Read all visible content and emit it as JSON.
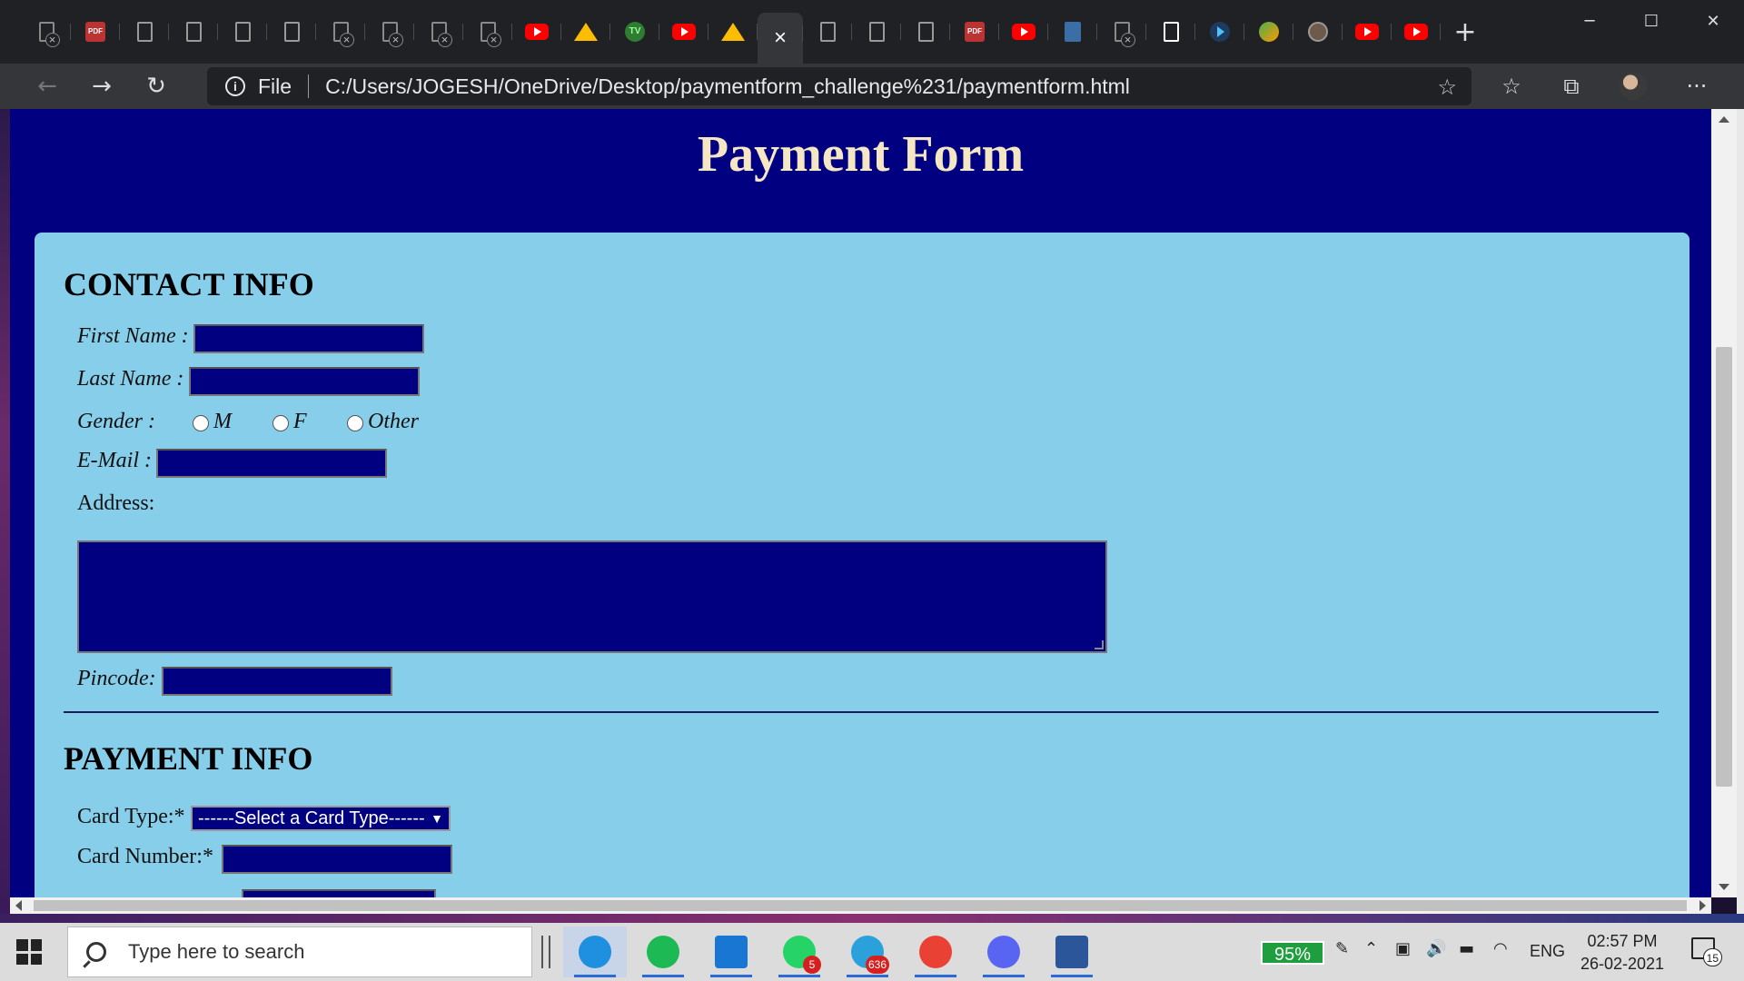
{
  "browser": {
    "tabs": [
      {
        "icon": "blocked-doc-icon"
      },
      {
        "icon": "pdf-icon"
      },
      {
        "icon": "doc-icon"
      },
      {
        "icon": "doc-icon"
      },
      {
        "icon": "doc-icon"
      },
      {
        "icon": "doc-icon"
      },
      {
        "icon": "blocked-doc-icon"
      },
      {
        "icon": "blocked-doc-icon"
      },
      {
        "icon": "blocked-doc-icon"
      },
      {
        "icon": "blocked-doc-icon"
      },
      {
        "icon": "youtube-icon"
      },
      {
        "icon": "google-drive-icon"
      },
      {
        "icon": "tradingview-icon"
      },
      {
        "icon": "youtube-icon"
      },
      {
        "icon": "google-drive-icon"
      },
      {
        "icon": "active-tab",
        "close_glyph": "×"
      },
      {
        "icon": "doc-icon"
      },
      {
        "icon": "doc-icon"
      },
      {
        "icon": "doc-icon"
      },
      {
        "icon": "pdf-icon"
      },
      {
        "icon": "youtube-icon"
      },
      {
        "icon": "book-icon"
      },
      {
        "icon": "blocked-doc-icon"
      },
      {
        "icon": "white-doc-icon"
      },
      {
        "icon": "play-icon"
      },
      {
        "icon": "green-app-icon"
      },
      {
        "icon": "circle-app-icon"
      },
      {
        "icon": "youtube-icon"
      },
      {
        "icon": "youtube-icon"
      }
    ],
    "new_tab_glyph": "+",
    "window_controls": {
      "minimize": "─",
      "maximize": "☐",
      "close": "✕"
    },
    "nav": {
      "back": "←",
      "forward": "→",
      "reload": "↻"
    },
    "address": {
      "scheme_label": "File",
      "url": "C:/Users/JOGESH/OneDrive/Desktop/paymentform_challenge%231/paymentform.html"
    },
    "right_icons": {
      "add_favorite": "☆",
      "favorites": "☆",
      "collections": "⧉",
      "more": "···"
    }
  },
  "page": {
    "title": "Payment Form",
    "contact": {
      "heading": "CONTACT INFO",
      "first_name_label": "First Name :",
      "last_name_label": "Last Name :",
      "gender_label": "Gender :",
      "gender_options": [
        "M",
        "F",
        "Other"
      ],
      "email_label": "E-Mail :",
      "address_label": "Address:",
      "pincode_label": "Pincode:"
    },
    "payment": {
      "heading": "PAYMENT INFO",
      "card_type_label": "Card Type:*",
      "card_type_selected": "------Select a Card Type------",
      "card_number_label": "Card Number:*"
    },
    "colors": {
      "page_bg": "#000080",
      "card_bg": "#87ceeb",
      "title_color": "#f5e6c4",
      "field_bg": "#000080"
    }
  },
  "taskbar": {
    "search_placeholder": "Type here to search",
    "apps": [
      {
        "name": "edge-icon",
        "color": "#1f8fe0",
        "active": true
      },
      {
        "name": "spotify-icon",
        "color": "#1db954"
      },
      {
        "name": "instagram-icon",
        "color": "#1976d2"
      },
      {
        "name": "whatsapp-icon",
        "color": "#25d366",
        "badge": "5"
      },
      {
        "name": "telegram-icon",
        "color": "#2aa1da",
        "badge": "636"
      },
      {
        "name": "chrome-icon",
        "color": "#e94235"
      },
      {
        "name": "discord-icon",
        "color": "#5865f2"
      },
      {
        "name": "word-icon",
        "color": "#2b579a"
      }
    ],
    "battery_percent": "95%",
    "language": "ENG",
    "time": "02:57 PM",
    "date": "26-02-2021",
    "notifications": "15"
  }
}
